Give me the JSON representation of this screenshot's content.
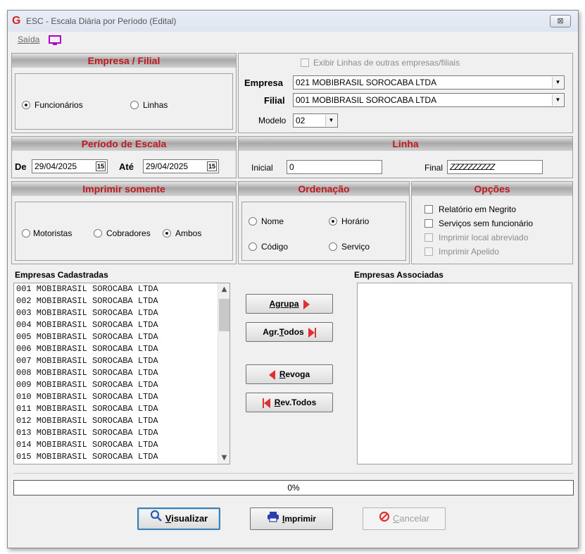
{
  "window": {
    "title": "ESC - Escala Diária por Período (Edital)",
    "app_logo": "G",
    "close_glyph": "⊠"
  },
  "menu": {
    "saida": "Saída",
    "icon": "monitor-icon"
  },
  "empresa_filial": {
    "header": "Empresa / Filial",
    "radio_funcionarios": "Funcionários",
    "radio_linhas": "Linhas",
    "selected": "Funcionários"
  },
  "company": {
    "show_others_label": "Exibir Linhas de outras empresas/filiais",
    "empresa_label": "Empresa",
    "empresa_value": "021 MOBIBRASIL SOROCABA LTDA",
    "filial_label": "Filial",
    "filial_value": "001 MOBIBRASIL SOROCABA LTDA",
    "modelo_label": "Modelo",
    "modelo_value": "02"
  },
  "periodo": {
    "header": "Período de Escala",
    "de_label": "De",
    "de_value": "29/04/2025",
    "ate_label": "Até",
    "ate_value": "29/04/2025",
    "cal_glyph": "15"
  },
  "linha": {
    "header": "Linha",
    "inicial_label": "Inicial",
    "inicial_value": "0",
    "final_label": "Final",
    "final_value": "ZZZZZZZZZZ"
  },
  "imprimir": {
    "header": "Imprimir somente",
    "motoristas": "Motoristas",
    "cobradores": "Cobradores",
    "ambos": "Ambos",
    "selected": "Ambos"
  },
  "ordenacao": {
    "header": "Ordenação",
    "nome": "Nome",
    "horario": "Horário",
    "codigo": "Código",
    "servico": "Serviço",
    "selected": "Horário"
  },
  "opcoes": {
    "header": "Opções",
    "items": [
      {
        "label": "Relatório em Negrito",
        "enabled": true
      },
      {
        "label": "Serviços sem funcionário",
        "enabled": true
      },
      {
        "label": "Imprimir local abreviado",
        "enabled": false
      },
      {
        "label": "Imprimir Apelido",
        "enabled": false
      }
    ]
  },
  "empresas_cadastradas": {
    "label": "Empresas Cadastradas",
    "items": [
      "001 MOBIBRASIL SOROCABA LTDA",
      "002 MOBIBRASIL SOROCABA LTDA",
      "003 MOBIBRASIL SOROCABA LTDA",
      "004 MOBIBRASIL SOROCABA LTDA",
      "005 MOBIBRASIL SOROCABA LTDA",
      "006 MOBIBRASIL SOROCABA LTDA",
      "007 MOBIBRASIL SOROCABA LTDA",
      "008 MOBIBRASIL SOROCABA LTDA",
      "009 MOBIBRASIL SOROCABA LTDA",
      "010 MOBIBRASIL SOROCABA LTDA",
      "011 MOBIBRASIL SOROCABA LTDA",
      "012 MOBIBRASIL SOROCABA LTDA",
      "013 MOBIBRASIL SOROCABA LTDA",
      "014 MOBIBRASIL SOROCABA LTDA",
      "015 MOBIBRASIL SOROCABA LTDA"
    ]
  },
  "empresas_associadas": {
    "label": "Empresas Associadas",
    "items": []
  },
  "transfer": {
    "agrupa": "Agrupa",
    "agr_todos_prefix": "Agr.",
    "agr_todos_u": "T",
    "agr_todos_suffix": "odos",
    "revoga_u": "R",
    "revoga_suffix": "evoga",
    "rev_todos_u": "R",
    "rev_todos_suffix": "ev.Todos"
  },
  "progress": {
    "text": "0%",
    "value": 0
  },
  "footer": {
    "visualizar_u": "V",
    "visualizar_suffix": "isualizar",
    "imprimir_u": "I",
    "imprimir_suffix": "mprimir",
    "cancelar_u": "C",
    "cancelar_suffix": "ancelar"
  },
  "colors": {
    "header_text": "#c0181f",
    "accent_red": "#e03030",
    "primary_border": "#3c7fb1"
  }
}
